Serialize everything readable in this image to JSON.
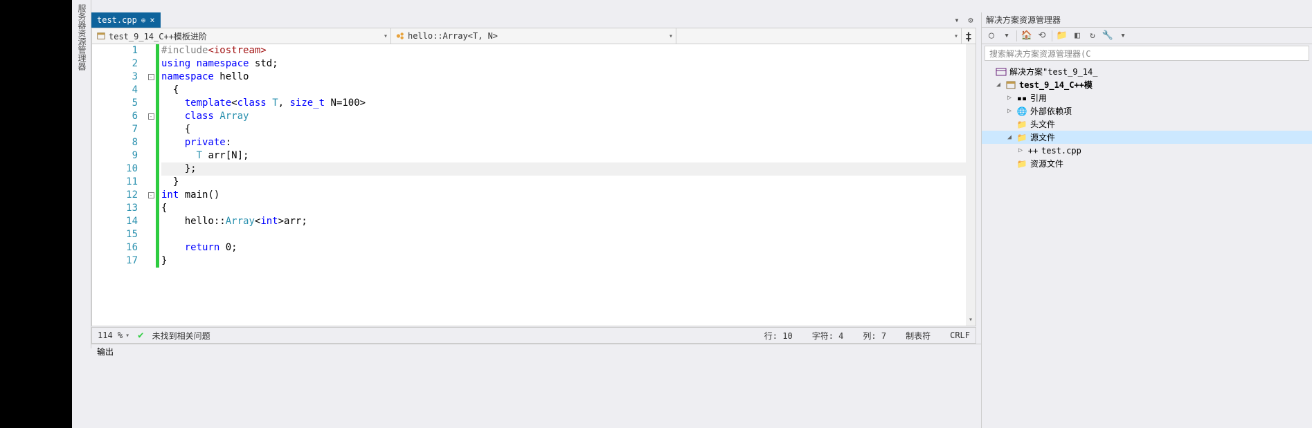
{
  "left_sidebar_label": "服务器资源管理器",
  "tab": {
    "name": "test.cpp",
    "pinned": true
  },
  "nav": {
    "scope": "test_9_14_C++模板进阶",
    "member": "hello::Array<T, N>",
    "third": ""
  },
  "code_lines": [
    {
      "n": 1,
      "html": "<span class='pp'>#include</span><span class='str'>&lt;iostream&gt;</span>"
    },
    {
      "n": 2,
      "html": "<span class='kw'>using</span> <span class='kw'>namespace</span> <span class='txt'>std;</span>"
    },
    {
      "n": 3,
      "html": "<span class='kw'>namespace</span> <span class='txt'>hello</span>",
      "fold": "-"
    },
    {
      "n": 4,
      "html": "  <span class='txt'>{</span>"
    },
    {
      "n": 5,
      "html": "    <span class='kw'>template</span><span class='txt'>&lt;</span><span class='kw'>class</span> <span class='cls'>T</span><span class='txt'>,</span> <span class='kw'>size_t</span> <span class='txt'>N=100&gt;</span>"
    },
    {
      "n": 6,
      "html": "    <span class='kw'>class</span> <span class='cls'>Array</span>",
      "fold": "-"
    },
    {
      "n": 7,
      "html": "    <span class='txt'>{</span>"
    },
    {
      "n": 8,
      "html": "    <span class='kw'>private</span><span class='txt'>:</span>"
    },
    {
      "n": 9,
      "html": "      <span class='cls'>T</span> <span class='txt'>arr[N];</span>"
    },
    {
      "n": 10,
      "html": "    <span class='txt'>};</span>",
      "current": true
    },
    {
      "n": 11,
      "html": "  <span class='txt'>}</span>"
    },
    {
      "n": 12,
      "html": "<span class='kw'>int</span> <span class='txt'>main()</span>",
      "fold": "-"
    },
    {
      "n": 13,
      "html": "<span class='txt'>{</span>"
    },
    {
      "n": 14,
      "html": "    <span class='txt'>hello::</span><span class='cls'>Array</span><span class='txt'>&lt;</span><span class='kw'>int</span><span class='txt'>&gt;arr;</span>"
    },
    {
      "n": 15,
      "html": ""
    },
    {
      "n": 16,
      "html": "    <span class='kw'>return</span> <span class='txt'>0;</span>"
    },
    {
      "n": 17,
      "html": "<span class='txt'>}</span>"
    }
  ],
  "status": {
    "zoom": "114 %",
    "issues": "未找到相关问题",
    "line": "行: 10",
    "char": "字符: 4",
    "col": "列: 7",
    "tabs": "制表符",
    "eol": "CRLF"
  },
  "output_title": "输出",
  "solution_panel": {
    "title": "解决方案资源管理器",
    "search_placeholder": "搜索解决方案资源管理器(C",
    "solution": "解决方案\"test_9_14_",
    "project": "test_9_14_C++模",
    "refs": "引用",
    "external": "外部依赖项",
    "headers": "头文件",
    "sources": "源文件",
    "source_file": "test.cpp",
    "resources": "资源文件"
  }
}
